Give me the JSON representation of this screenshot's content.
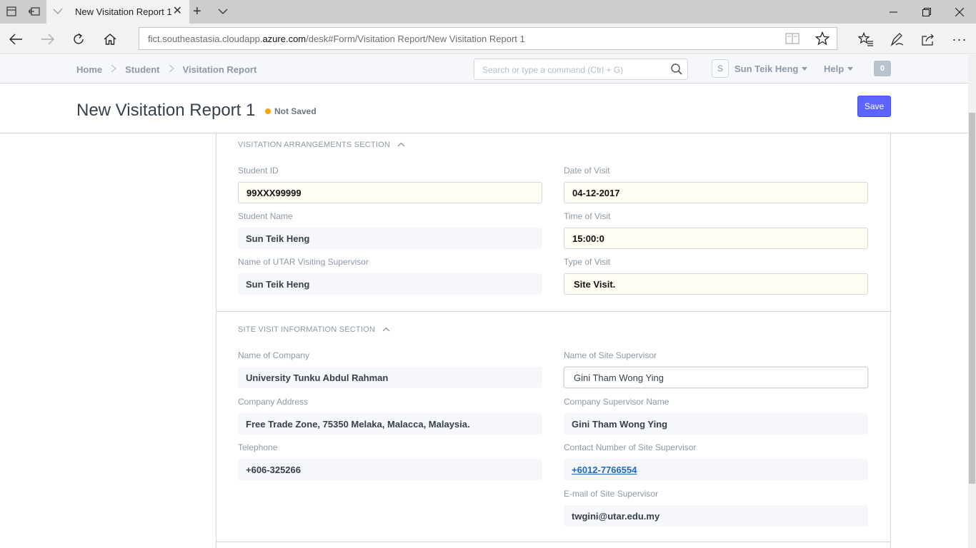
{
  "browser": {
    "tab_title": "New Visitation Report 1",
    "url_prefix": "fict.southeastasia.cloudapp.",
    "url_domain": "azure.com",
    "url_suffix": "/desk#Form/Visitation Report/New Visitation Report 1"
  },
  "appbar": {
    "breadcrumbs": [
      "Home",
      "Student",
      "Visitation Report"
    ],
    "search_placeholder": "Search or type a command (Ctrl + G)",
    "avatar_letter": "S",
    "user_name": "Sun Teik Heng",
    "help_label": "Help",
    "notification_count": "0"
  },
  "page": {
    "title": "New Visitation Report 1",
    "status": "Not Saved",
    "status_color": "#ffa00a",
    "save_label": "Save",
    "accent_color": "#5e64ff"
  },
  "sections": {
    "arrangements": {
      "title": "VISITATION ARRANGEMENTS SECTION",
      "student_id_label": "Student ID",
      "student_id_value": "99XXX99999",
      "student_name_label": "Student Name",
      "student_name_value": "Sun Teik Heng",
      "supervisor_label": "Name of UTAR Visiting Supervisor",
      "supervisor_value": "Sun Teik Heng",
      "date_label": "Date of Visit",
      "date_value": "04-12-2017",
      "time_label": "Time of Visit",
      "time_value": "15:00:0",
      "type_label": "Type of Visit",
      "type_value": "Site Visit."
    },
    "site_info": {
      "title": "SITE VISIT INFORMATION SECTION",
      "company_label": "Name of Company",
      "company_value": "University Tunku Abdul Rahman",
      "address_label": "Company Address",
      "address_value": "Free Trade Zone, 75350 Melaka, Malacca, Malaysia.",
      "telephone_label": "Telephone",
      "telephone_value": "+606-325266",
      "site_supervisor_label": "Name of Site Supervisor",
      "site_supervisor_value": "Gini Tham Wong Ying",
      "company_supervisor_label": "Company Supervisor Name",
      "company_supervisor_value": "Gini Tham Wong Ying",
      "contact_label": "Contact Number of Site Supervisor",
      "contact_value": "+6012-7766554",
      "email_label": "E-mail of Site Supervisor",
      "email_value": "twgini@utar.edu.my"
    }
  }
}
